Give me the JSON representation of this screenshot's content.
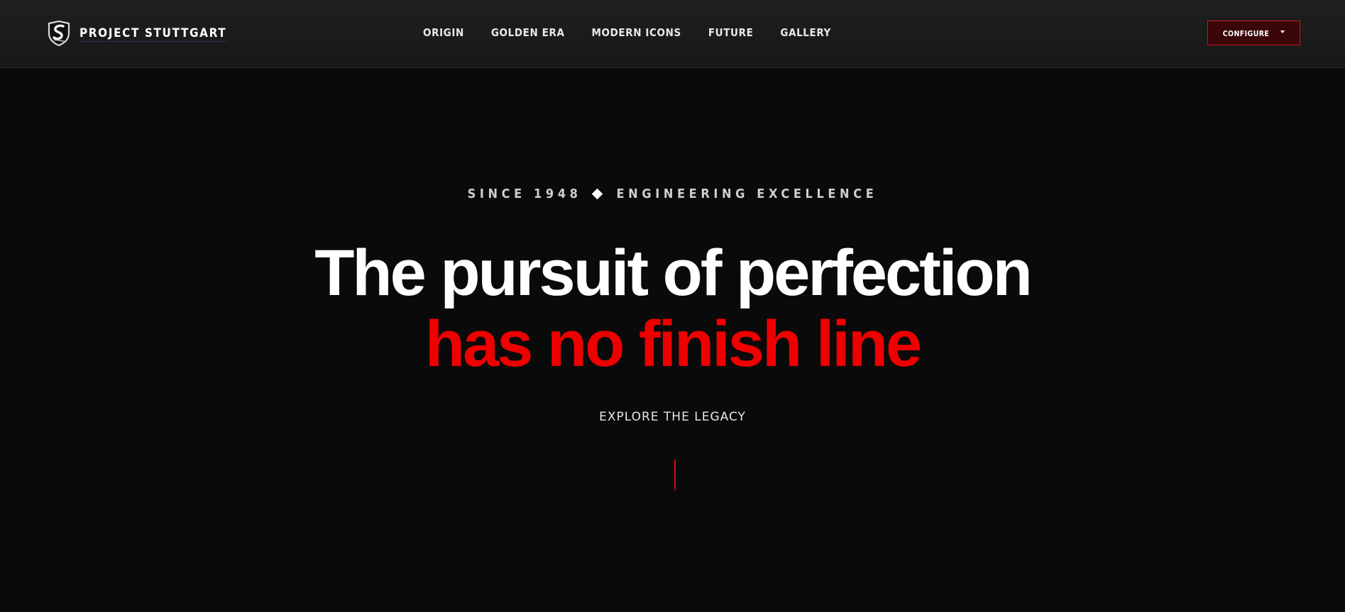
{
  "header": {
    "brand_name": "PROJECT STUTTGART",
    "logo_icon": "shield-s-logo",
    "nav": [
      {
        "label": "ORIGIN"
      },
      {
        "label": "GOLDEN ERA"
      },
      {
        "label": "MODERN ICONS"
      },
      {
        "label": "FUTURE"
      },
      {
        "label": "GALLERY"
      }
    ],
    "configure": {
      "label": "CONFIGURE",
      "icon": "caret-down-icon"
    }
  },
  "hero": {
    "eyebrow_left": "SINCE 1948",
    "eyebrow_right": "ENGINEERING EXCELLENCE",
    "eyebrow_separator_icon": "diamond-icon",
    "headline_line1": "The pursuit of perfection",
    "headline_line2": "has no finish line",
    "cta": "EXPLORE THE LEGACY"
  },
  "colors": {
    "background": "#0a0a0a",
    "header_background": "#1c1c1c",
    "accent_red": "#ee0000",
    "button_fill": "#3a0608",
    "button_border": "#d2141b"
  }
}
